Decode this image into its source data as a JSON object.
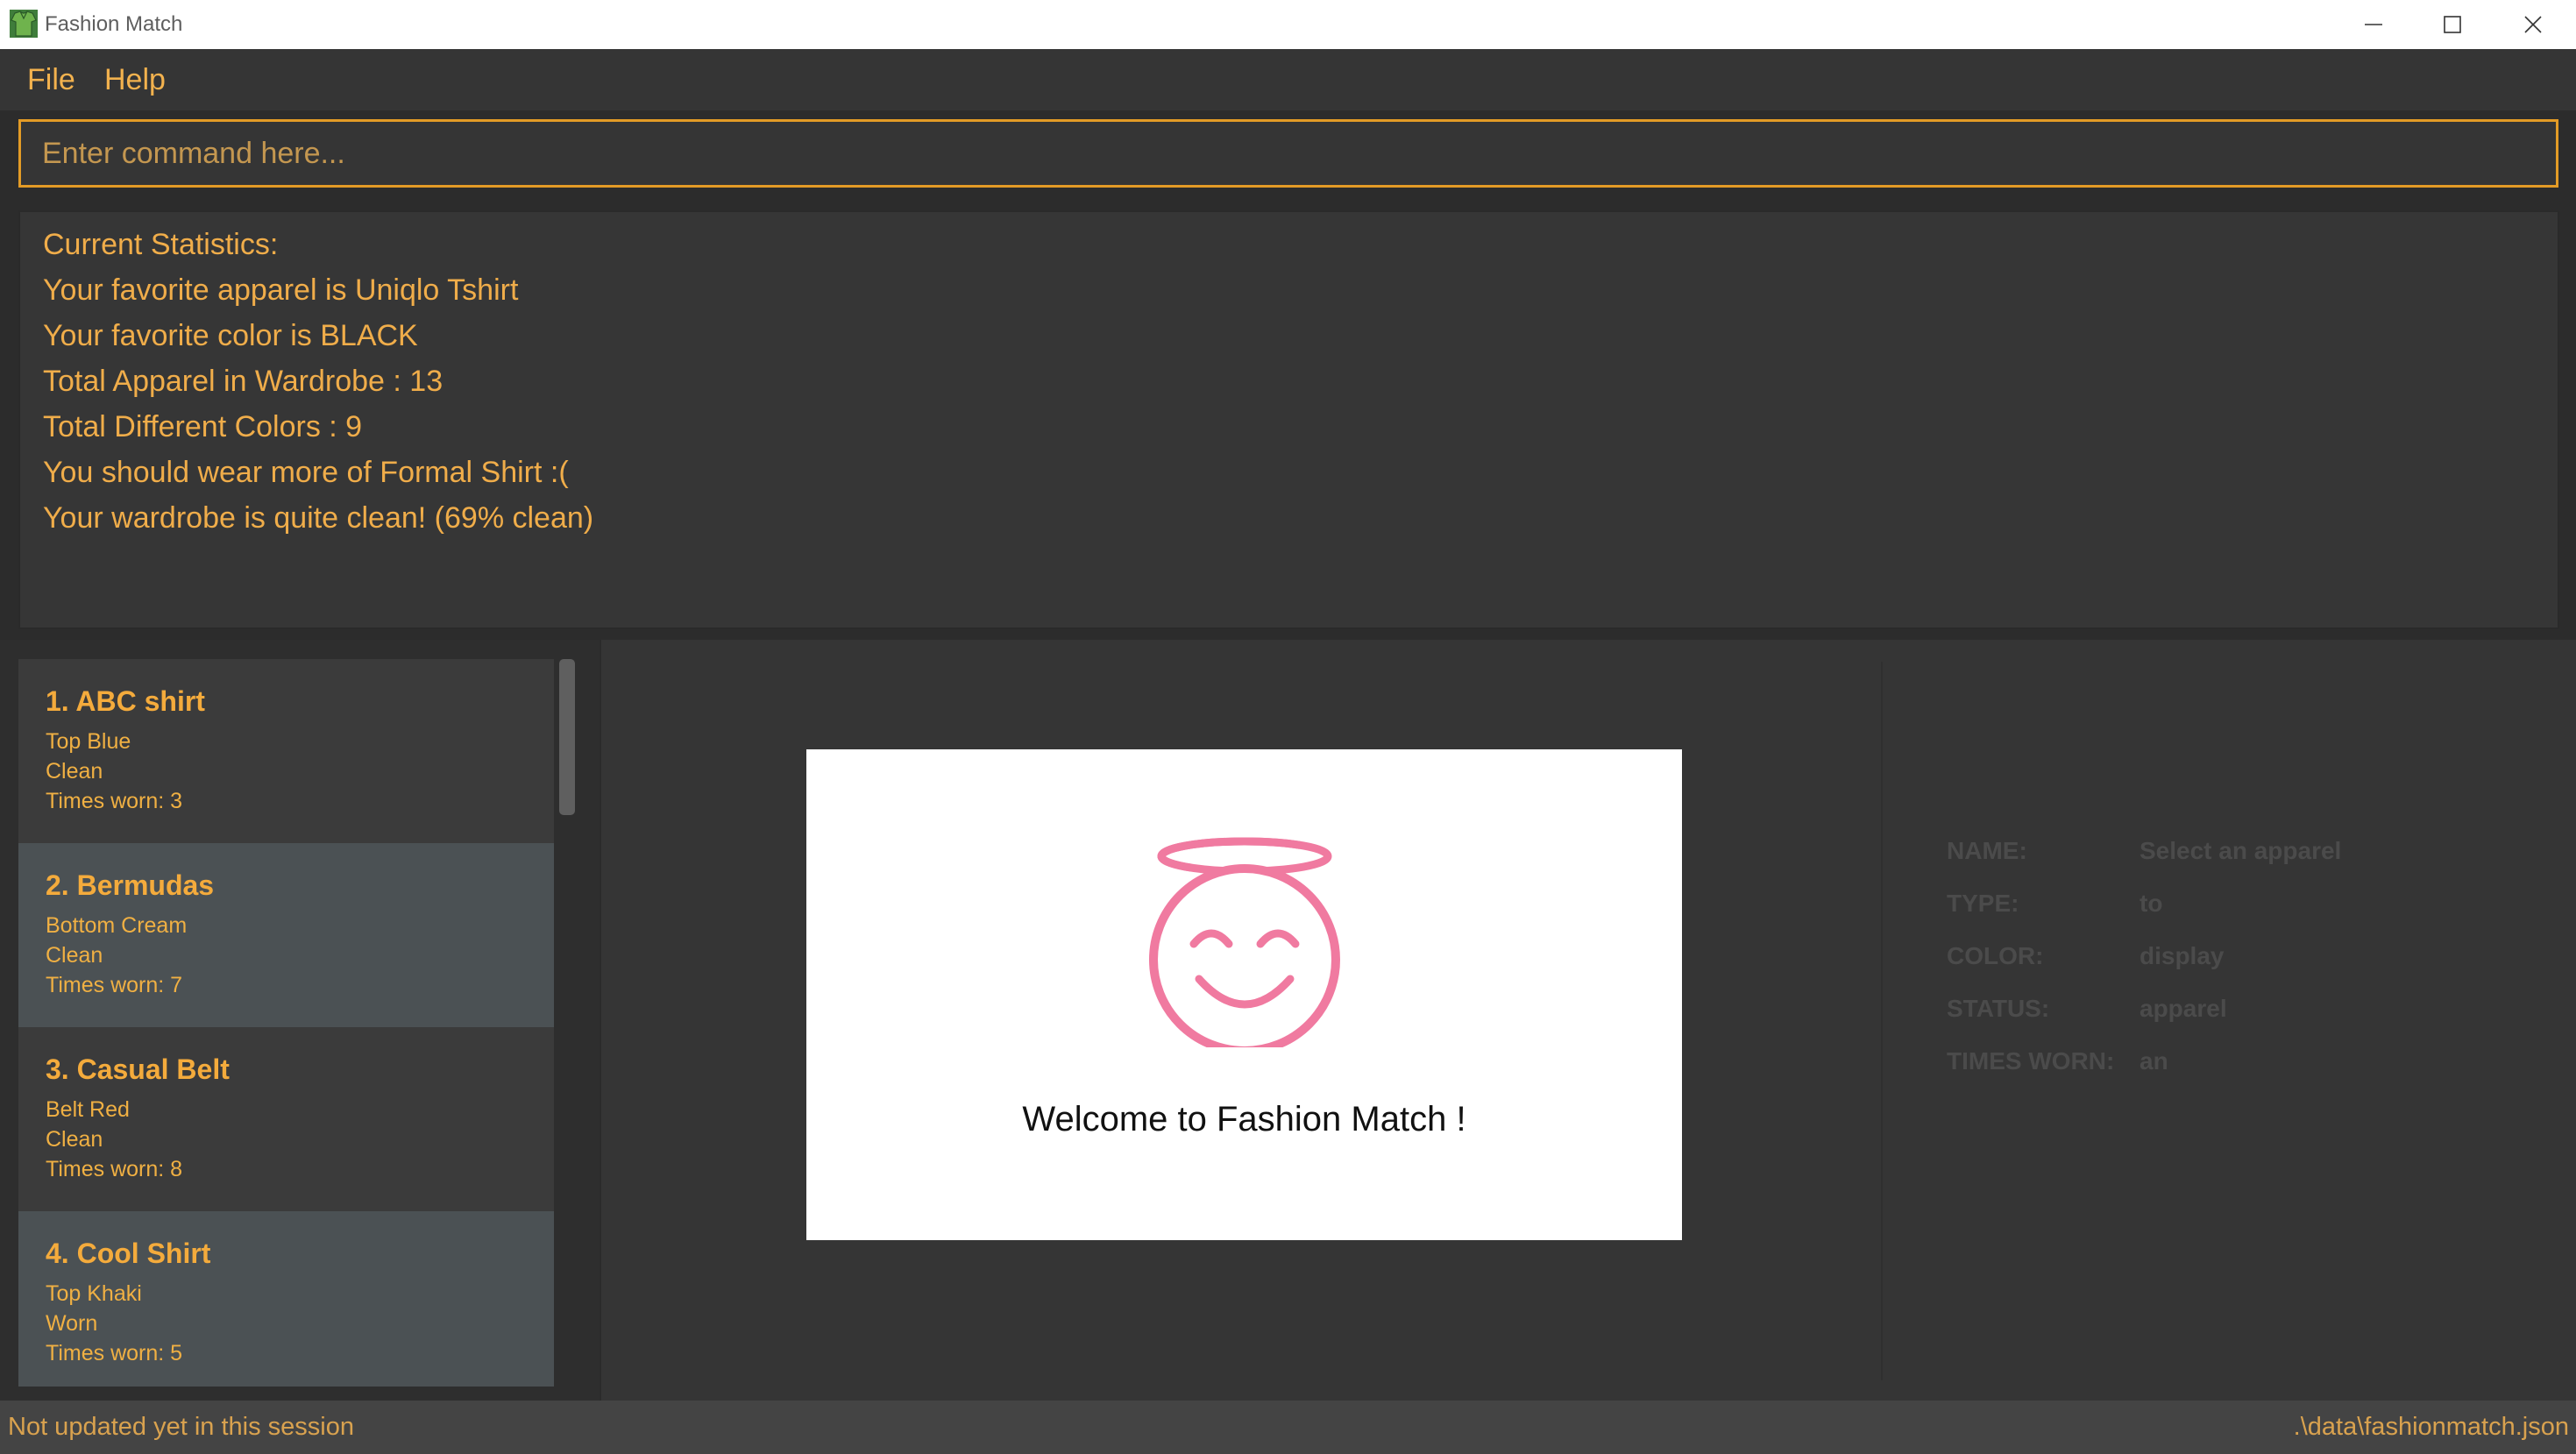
{
  "window": {
    "title": "Fashion Match",
    "icon": "app-shirt-icon",
    "controls": [
      "minimize-icon",
      "maximize-icon",
      "close-icon"
    ]
  },
  "menu": {
    "file": "File",
    "help": "Help"
  },
  "command": {
    "placeholder": "Enter command here...",
    "value": ""
  },
  "result": {
    "lines": [
      "Current Statistics:",
      "Your favorite apparel is Uniqlo Tshirt",
      "Your favorite color is BLACK",
      "Total Apparel in Wardrobe : 13",
      "Total Different Colors : 9",
      "You should wear more of Formal Shirt :(",
      "Your wardrobe is quite clean! (69% clean)"
    ]
  },
  "apparel_list": [
    {
      "title": "1.  ABC shirt",
      "type_color": "Top  Blue",
      "status": "Clean",
      "worn": "Times worn: 3"
    },
    {
      "title": "2.  Bermudas",
      "type_color": "Bottom  Cream",
      "status": "Clean",
      "worn": "Times worn: 7"
    },
    {
      "title": "3.  Casual Belt",
      "type_color": "Belt  Red",
      "status": "Clean",
      "worn": "Times worn: 8"
    },
    {
      "title": "4.  Cool Shirt",
      "type_color": "Top  Khaki",
      "status": "Worn",
      "worn": "Times worn: 5"
    }
  ],
  "welcome": {
    "text": "Welcome to Fashion Match !",
    "icon": "smiling-angel-face-icon",
    "icon_color": "#f07aa0"
  },
  "details": {
    "labels": [
      "NAME:",
      "TYPE:",
      "COLOR:",
      "STATUS:",
      "TIMES WORN:"
    ],
    "values": [
      "Select an apparel",
      "to",
      "display",
      "apparel",
      "an"
    ]
  },
  "status": {
    "left": "Not updated yet in this session",
    "right": ".\\data\\fashionmatch.json"
  },
  "colors": {
    "accent": "#f3b24e",
    "background": "#353535",
    "selected_card": "#4b5154"
  }
}
